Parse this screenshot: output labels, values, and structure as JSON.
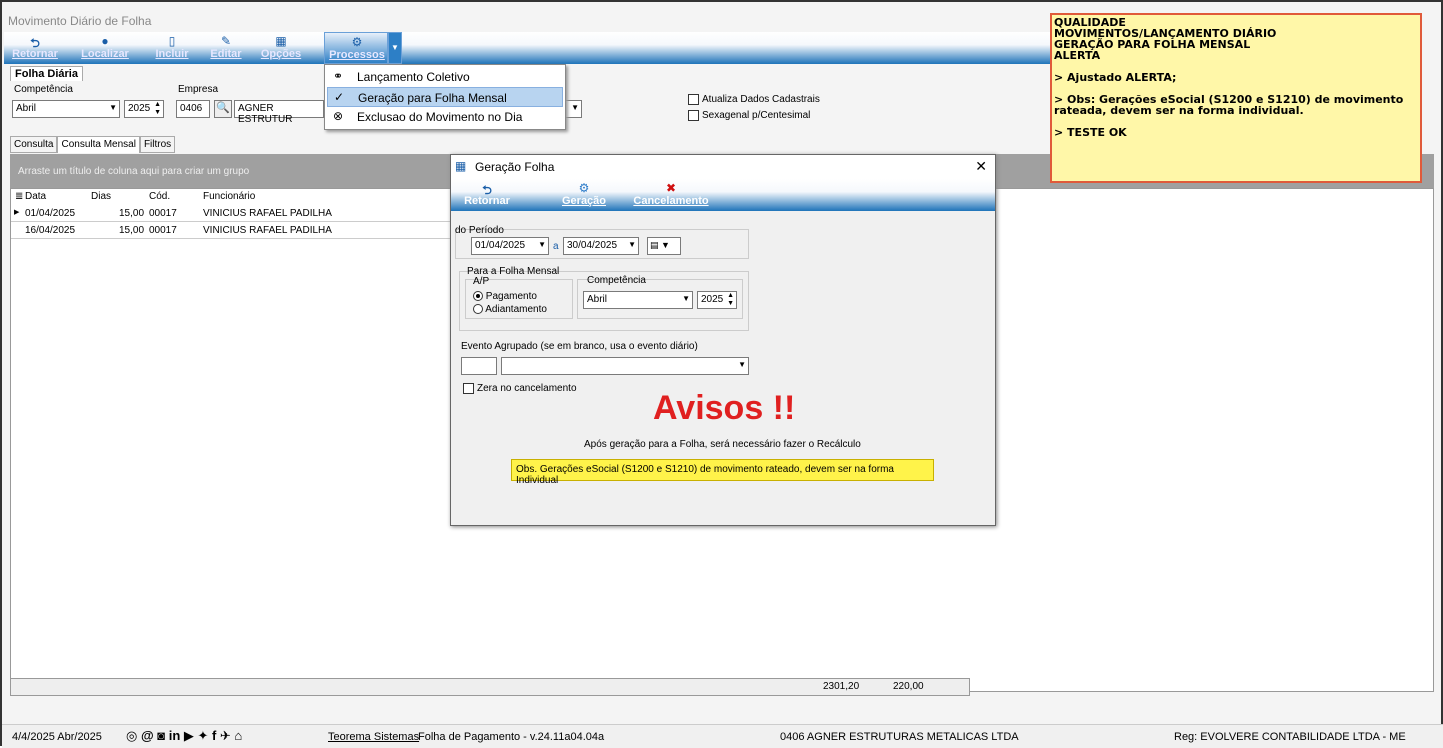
{
  "window": {
    "title": "Movimento Diário de Folha"
  },
  "toolbar": {
    "buttons": [
      {
        "label": "Retornar",
        "icon": "undo-icon"
      },
      {
        "label": "Localizar",
        "icon": "search-icon"
      },
      {
        "label": "Incluir",
        "icon": "new-doc-icon"
      },
      {
        "label": "Editar",
        "icon": "edit-icon"
      },
      {
        "label": "Opções",
        "icon": "options-icon"
      },
      {
        "label": "Processos",
        "icon": "process-icon"
      }
    ]
  },
  "main_tab": "Folha Diária",
  "filters": {
    "competencia_label": "Competência",
    "competencia_month": "Abril",
    "competencia_year": "2025",
    "empresa_label": "Empresa",
    "empresa_code": "0406",
    "empresa_name": "AGNER ESTRUTUR",
    "atualiza_label": "Atualiza Dados Cadastrais",
    "sexagenal_label": "Sexagenal p/Centesimal"
  },
  "subtabs": [
    "Consulta",
    "Consulta Mensal",
    "Filtros"
  ],
  "group_hint": "Arraste um título de coluna aqui para criar um grupo",
  "grid": {
    "columns": [
      "Data",
      "Dias",
      "Cód.",
      "Funcionário"
    ],
    "rows": [
      {
        "data": "01/04/2025",
        "dias": "15,00",
        "cod": "00017",
        "func": "VINICIUS RAFAEL PADILHA"
      },
      {
        "data": "16/04/2025",
        "dias": "15,00",
        "cod": "00017",
        "func": "VINICIUS RAFAEL PADILHA"
      }
    ],
    "totals": {
      "t1": "2301,20",
      "t2": "220,00"
    }
  },
  "menu": {
    "items": [
      {
        "label": "Lançamento Coletivo",
        "icon": "group-icon"
      },
      {
        "label": "Geração para Folha Mensal",
        "icon": "generate-icon"
      },
      {
        "label": "Exclusao do Movimento no Dia",
        "icon": "delete-icon"
      }
    ]
  },
  "alert": {
    "lines": [
      "QUALIDADE",
      "MOVIMENTOS/LANÇAMENTO DIÁRIO",
      "GERAÇÃO PARA FOLHA MENSAL",
      "ALERTA",
      "",
      "> Ajustado ALERTA;",
      "",
      "> Obs: Gerações eSocial (S1200 e S1210) de movimento rateada, devem ser na forma individual.",
      "",
      "> TESTE OK"
    ]
  },
  "dialog": {
    "title": "Geração Folha",
    "buttons": [
      "Retornar",
      "Geração",
      "Cancelamento"
    ],
    "periodo_label": "do Período",
    "periodo_from": "01/04/2025",
    "periodo_sep": "a",
    "periodo_to": "30/04/2025",
    "folha_label": "Para a Folha Mensal",
    "ap_label": "A/P",
    "radio_pagamento": "Pagamento",
    "radio_adiantamento": "Adiantamento",
    "comp_label": "Competência",
    "comp_month": "Abril",
    "comp_year": "2025",
    "evento_label": "Evento Agrupado (se em branco, usa o evento diário)",
    "zera_label": "Zera no cancelamento",
    "avisos": "Avisos !!",
    "apos": "Após geração para a Folha, será necessário fazer o Recálculo",
    "obs": "Obs. Gerações eSocial (S1200 e S1210) de movimento rateado, devem ser na forma Individual"
  },
  "status": {
    "date": "4/4/2025 Abr/2025",
    "company_link": "Teorema Sistemas",
    "version": "Folha de Pagamento - v.24.11a04.04a",
    "empresa": "0406 AGNER ESTRUTURAS METALICAS LTDA",
    "reg": "Reg: EVOLVERE CONTABILIDADE LTDA - ME"
  }
}
